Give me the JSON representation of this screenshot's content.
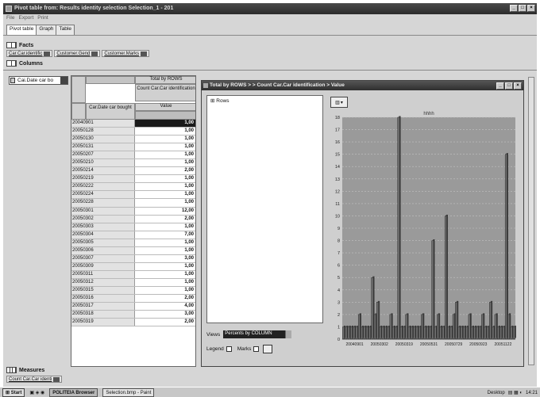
{
  "window": {
    "title": "Pivot table from: Results identity selection Selection_1 - 201"
  },
  "menu": [
    "File",
    "Export",
    "Print"
  ],
  "tabs": [
    {
      "label": "Pivot table"
    },
    {
      "label": "Graph"
    },
    {
      "label": "Table"
    }
  ],
  "facts": {
    "label": "Facts",
    "chips": [
      "Car.Car.identific",
      "Customer.Gend",
      "Customer.Marks"
    ]
  },
  "columns": {
    "label": "Columns"
  },
  "rows_selector": {
    "value": "Cai.Date car bo"
  },
  "grid": {
    "total_header": "Total by ROWS",
    "measure_header": "Count Car.Car identification",
    "date_header": "Car.Date car bought",
    "value_header": "Value",
    "rows": [
      {
        "date": "20040901",
        "value": "1,00"
      },
      {
        "date": "20050128",
        "value": "1,00"
      },
      {
        "date": "20050130",
        "value": "1,00"
      },
      {
        "date": "20050131",
        "value": "1,00"
      },
      {
        "date": "20050207",
        "value": "1,00"
      },
      {
        "date": "20050210",
        "value": "1,00"
      },
      {
        "date": "20050214",
        "value": "2,00"
      },
      {
        "date": "20050219",
        "value": "1,00"
      },
      {
        "date": "20050222",
        "value": "1,00"
      },
      {
        "date": "20050224",
        "value": "1,00"
      },
      {
        "date": "20050228",
        "value": "1,00"
      },
      {
        "date": "20050301",
        "value": "12,00"
      },
      {
        "date": "20050302",
        "value": "2,00"
      },
      {
        "date": "20050303",
        "value": "1,00"
      },
      {
        "date": "20050304",
        "value": "7,00"
      },
      {
        "date": "20050305",
        "value": "1,00"
      },
      {
        "date": "20050306",
        "value": "1,00"
      },
      {
        "date": "20050307",
        "value": "3,00"
      },
      {
        "date": "20050309",
        "value": "1,00"
      },
      {
        "date": "20050311",
        "value": "1,00"
      },
      {
        "date": "20050312",
        "value": "1,00"
      },
      {
        "date": "20050315",
        "value": "1,00"
      },
      {
        "date": "20050316",
        "value": "2,00"
      },
      {
        "date": "20050317",
        "value": "4,00"
      },
      {
        "date": "20050318",
        "value": "3,00"
      },
      {
        "date": "20050319",
        "value": "2,00"
      }
    ]
  },
  "chart_window": {
    "title": "Total by ROWS > > Count Car.Car identification > Value"
  },
  "tree": {
    "root": "Rows"
  },
  "views": {
    "label": "Views",
    "value": "Percents by COLUMN"
  },
  "legend": {
    "legend_label": "Legend",
    "marks_label": "Marks"
  },
  "measures": {
    "label": "Measures",
    "chip": "Count Car.Car identi"
  },
  "taskbar": {
    "start": "Start",
    "tasks": [
      "POLITEIA Browser",
      "Selection.bmp - Paint"
    ],
    "desktop": "Desktop",
    "time": "14:21"
  },
  "chart_data": {
    "type": "bar",
    "legend_label": "hhhh",
    "xtick_labels": [
      "20040901",
      "20050302",
      "20050319",
      "20050531",
      "20050729",
      "20050923",
      "20051122"
    ],
    "ylim": [
      0,
      18
    ],
    "yticks": [
      0,
      1,
      2,
      3,
      4,
      5,
      6,
      7,
      8,
      9,
      10,
      11,
      12,
      13,
      14,
      15,
      16,
      17,
      18
    ],
    "grid": true,
    "values": [
      1,
      1,
      1,
      1,
      1,
      1,
      2,
      1,
      1,
      1,
      1,
      5,
      2,
      3,
      1,
      1,
      1,
      1,
      2,
      1,
      1,
      18,
      1,
      1,
      2,
      1,
      1,
      1,
      1,
      1,
      2,
      1,
      1,
      1,
      8,
      1,
      2,
      1,
      1,
      10,
      1,
      1,
      2,
      3,
      1,
      1,
      1,
      1,
      2,
      1,
      1,
      1,
      1,
      2,
      1,
      1,
      3,
      1,
      2,
      1,
      1,
      1,
      15,
      2,
      1,
      1
    ]
  }
}
